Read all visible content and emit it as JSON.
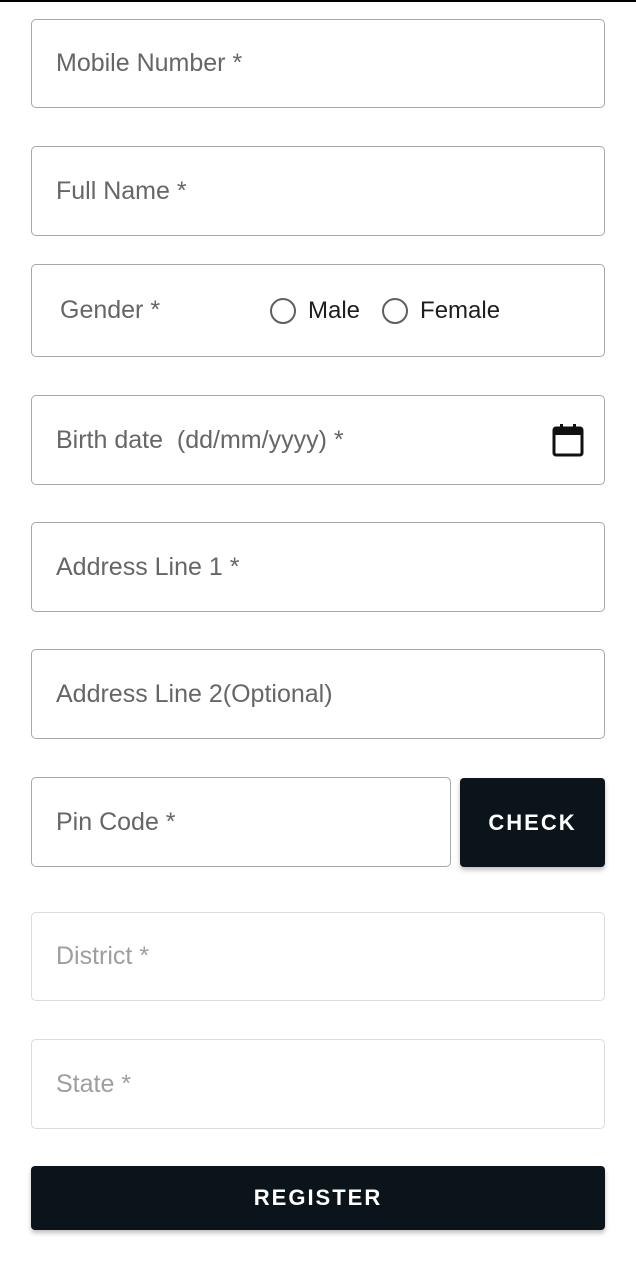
{
  "form": {
    "mobile_number": {
      "placeholder": "Mobile Number *",
      "value": ""
    },
    "full_name": {
      "placeholder": "Full Name *",
      "value": ""
    },
    "gender": {
      "label": "Gender *",
      "options": [
        "Male",
        "Female"
      ],
      "selected": ""
    },
    "birth_date": {
      "placeholder": "Birth date  (dd/mm/yyyy) *",
      "icon": "calendar-icon",
      "value": ""
    },
    "address_line_1": {
      "placeholder": "Address Line 1 *",
      "value": ""
    },
    "address_line_2": {
      "placeholder": "Address Line 2(Optional)",
      "value": ""
    },
    "pin_code": {
      "placeholder": "Pin Code *",
      "value": ""
    },
    "check_button": {
      "label": "CHECK"
    },
    "district": {
      "placeholder": "District *",
      "value": "",
      "disabled": true
    },
    "state": {
      "placeholder": "State *",
      "value": "",
      "disabled": true
    },
    "register_button": {
      "label": "REGISTER"
    }
  },
  "colors": {
    "button_bg": "#0b141a",
    "button_text": "#ffffff",
    "field_border": "#a8a8a8",
    "disabled_border": "#dcdcdc",
    "placeholder_text": "#666666",
    "disabled_text": "#9e9e9e"
  }
}
